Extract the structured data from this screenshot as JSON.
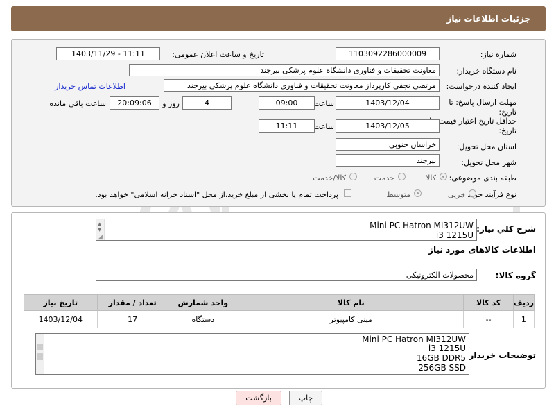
{
  "header": {
    "title": "جزئیات اطلاعات نیاز"
  },
  "form": {
    "need_number": {
      "label": "شماره نیاز:",
      "value": "1103092286000009"
    },
    "announce": {
      "label": "تاریخ و ساعت اعلان عمومی:",
      "value": "1403/11/29 - 11:11"
    },
    "buyer_org": {
      "label": "نام دستگاه خریدار:",
      "value": "معاونت تحقیقات و فناوری دانشگاه علوم پزشکی بیرجند"
    },
    "requester": {
      "label": "ایجاد کننده درخواست:",
      "value": "مرتضی نجفی کارپرداز معاونت تحقیقات و فناوری دانشگاه علوم پزشکی بیرجند",
      "contact_link": "اطلاعات تماس خریدار"
    },
    "reply_deadline": {
      "label_line1": "مهلت ارسال پاسخ: تا",
      "label_line2": "تاریخ:",
      "date": "1403/12/04",
      "time_label": "ساعت",
      "time": "09:00",
      "days": "4",
      "days_label": "روز و",
      "remaining": "20:09:06",
      "remaining_label": "ساعت باقی مانده"
    },
    "price_validity": {
      "label_line1": "حداقل تاریخ اعتبار قیمت: تا",
      "label_line2": "تاریخ:",
      "date": "1403/12/05",
      "time_label": "ساعت",
      "time": "11:11"
    },
    "province": {
      "label": "استان محل تحویل:",
      "value": "خراسان جنوبی"
    },
    "city": {
      "label": "شهر محل تحویل:",
      "value": "بیرجند"
    },
    "category": {
      "label": "طبقه بندی موضوعی:",
      "options": [
        "کالا",
        "خدمت",
        "کالا/خدمت"
      ],
      "selected": "کالا"
    },
    "process": {
      "label": "نوع فرآیند خرید :",
      "options": [
        "جزیی",
        "متوسط"
      ],
      "payment_note": "پرداخت تمام یا بخشی از مبلغ خرید،از محل \"اسناد خزانه اسلامی\" خواهد بود."
    }
  },
  "description": {
    "label": "شرح كلي نياز:",
    "line1": "Mini PC Hatron MI312UW",
    "line2": "i3 1215U"
  },
  "items_section": {
    "title": "اطلاعات کالاهای مورد نیاز",
    "group_label": "گروه کالا:",
    "group_value": "محصولات الکترونیکی",
    "columns": [
      "ردیف",
      "کد کالا",
      "نام کالا",
      "واحد شمارش",
      "تعداد / مقدار",
      "تاریخ نیاز"
    ],
    "rows": [
      {
        "row": "1",
        "code": "--",
        "name": "مینی کامپیوتر",
        "unit": "دستگاه",
        "qty": "17",
        "date": "1403/12/04"
      }
    ],
    "buyer_notes_label": "توضیحات خریدار:",
    "buyer_notes": [
      "Mini PC Hatron MI312UW",
      "i3 1215U",
      "16GB DDR5",
      "256GB SSD"
    ]
  },
  "buttons": {
    "print": "چاپ",
    "back": "بازگشت"
  },
  "colors": {
    "header_bg": "#8b6a4d",
    "panel_bg": "#f3f3f3",
    "link": "#1a2bcc",
    "back_btn": "#fde2e2"
  }
}
